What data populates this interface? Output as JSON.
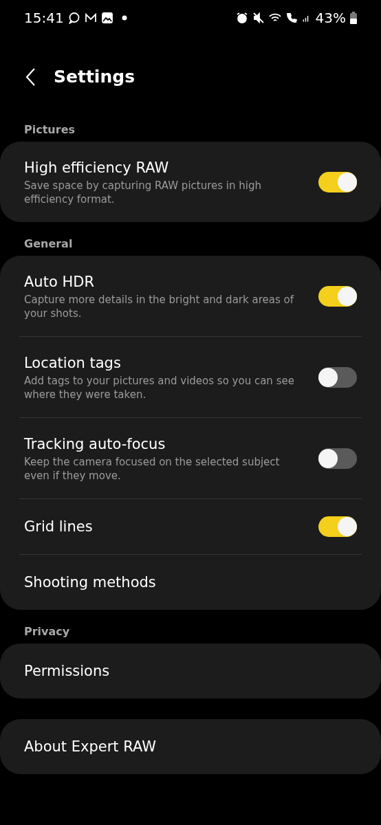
{
  "status_bar": {
    "time": "15:41",
    "battery": "43%"
  },
  "header": {
    "title": "Settings"
  },
  "sections": [
    {
      "label": "Pictures",
      "items": [
        {
          "kind": "toggle",
          "title": "High efficiency RAW",
          "description": "Save space by capturing RAW pictures in high efficiency format.",
          "on": true
        }
      ]
    },
    {
      "label": "General",
      "items": [
        {
          "kind": "toggle",
          "title": "Auto HDR",
          "description": "Capture more details in the bright and dark areas of your shots.",
          "on": true
        },
        {
          "kind": "toggle",
          "title": "Location tags",
          "description": "Add tags to your pictures and videos so you can see where they were taken.",
          "on": false
        },
        {
          "kind": "toggle",
          "title": "Tracking auto-focus",
          "description": "Keep the camera focused on the selected subject even if they move.",
          "on": false
        },
        {
          "kind": "toggle",
          "title": "Grid lines",
          "on": true
        },
        {
          "kind": "link",
          "title": "Shooting methods"
        }
      ]
    },
    {
      "label": "Privacy",
      "items": [
        {
          "kind": "link",
          "title": "Permissions"
        }
      ]
    },
    {
      "items": [
        {
          "kind": "link",
          "title": "About Expert RAW"
        }
      ]
    }
  ]
}
